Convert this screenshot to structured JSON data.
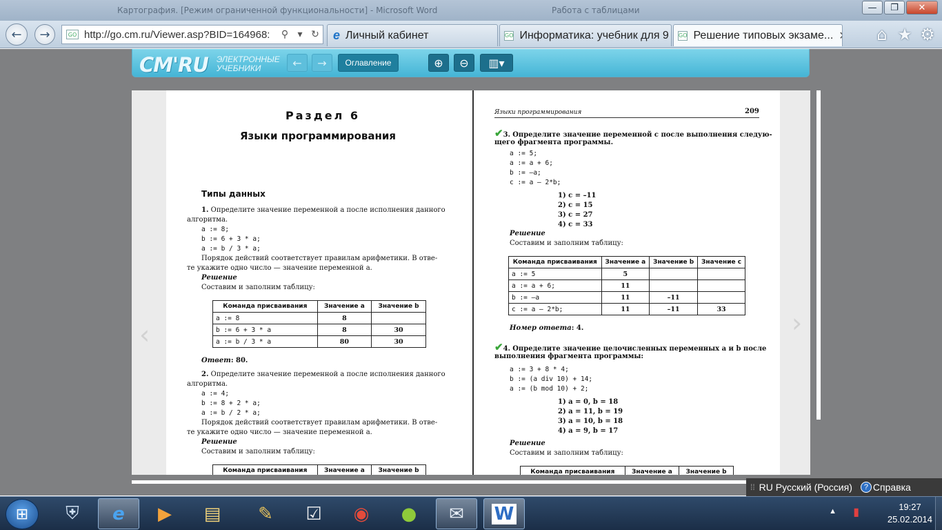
{
  "window": {
    "ghost_title": "Картография. [Режим ограниченной функциональности] - Microsoft Word",
    "ghost_title2": "Работа с таблицами",
    "buttons": {
      "minimize": "—",
      "maximize": "❐",
      "close": "✕"
    }
  },
  "browser": {
    "address": {
      "url": "http://go.cm.ru/Viewer.asp?BID=164968:",
      "favicon": "GO"
    },
    "tabs": [
      {
        "label": "Личный кабинет",
        "icon": "ie-icon",
        "active": false
      },
      {
        "label": "Информатика: учебник для 9 ...",
        "icon": "go-favicon",
        "active": false
      },
      {
        "label": "Решение типовых экзаме...",
        "icon": "go-favicon",
        "active": true,
        "close": "✕"
      }
    ],
    "tools": {
      "home": "⌂",
      "favorites": "★",
      "settings": "⚙"
    }
  },
  "reader": {
    "logo": "CM'RU",
    "logo_sub1": "ЭЛЕКТРОННЫЕ",
    "logo_sub2": "УЧЕБНИКИ",
    "toc_label": "Оглавление",
    "prev_page": "‹",
    "next_page": "›"
  },
  "left_page": {
    "section": "Раздел 6",
    "chapter": "Языки программирования",
    "subheading": "Типы данных",
    "q1": {
      "num": "1.",
      "text1": "Определите значение переменной a после исполнения данного",
      "text2": "алгоритма.",
      "code": [
        "a := 8;",
        "b := 6 + 3 * a;",
        "a := b / 3 * a;"
      ],
      "note1": "Порядок действий соответствует правилам арифметики. В отве-",
      "note2": "те укажите одно число — значение переменной a.",
      "solution": "Решение",
      "fill": "Составим и заполним таблицу:",
      "table": {
        "headers": [
          "Команда присваивания",
          "Значение a",
          "Значение b"
        ],
        "rows": [
          [
            "a := 8",
            "8",
            ""
          ],
          [
            "b := 6 + 3 * a",
            "8",
            "30"
          ],
          [
            "a := b / 3 * a",
            "80",
            "30"
          ]
        ]
      },
      "answer_label": "Ответ",
      "answer": ": 80."
    },
    "q2": {
      "num": "2.",
      "text1": "Определите значение переменной a после исполнения данного",
      "text2": "алгоритма.",
      "code": [
        "a := 4;",
        "b := 8 + 2 * a;",
        "a := b / 2 * a;"
      ],
      "note1": "Порядок действий соответствует правилам арифметики. В отве-",
      "note2": "те укажите одно число — значение переменной a.",
      "solution": "Решение",
      "fill": "Составим и заполним таблицу:",
      "table_headers": [
        "Команда присваивания",
        "Значение a",
        "Значение b"
      ]
    }
  },
  "right_page": {
    "running_head": "Языки программирования",
    "page_num": "209",
    "q3": {
      "num": "3.",
      "text1": "Определите значение переменной c после выполнения следую-",
      "text2": "щего фрагмента программы.",
      "code": [
        "a := 5;",
        "a := a + 6;",
        "b := –a;",
        "c := a – 2*b;"
      ],
      "options": [
        "1) c = –11",
        "2) c = 15",
        "3) c = 27",
        "4) c = 33"
      ],
      "solution": "Решение",
      "fill": "Составим и заполним таблицу:",
      "table": {
        "headers": [
          "Команда присваивания",
          "Значение a",
          "Значение b",
          "Значение c"
        ],
        "rows": [
          [
            "a := 5",
            "5",
            "",
            ""
          ],
          [
            "a := a + 6;",
            "11",
            "",
            ""
          ],
          [
            "b := –a",
            "11",
            "–11",
            ""
          ],
          [
            "c := a – 2*b;",
            "11",
            "–11",
            "33"
          ]
        ]
      },
      "answer_label": "Номер ответа",
      "answer": ": 4."
    },
    "q4": {
      "num": "4.",
      "text1": "Определите значение целочисленных переменных a и b после",
      "text2": "выполнения фрагмента программы:",
      "code": [
        "a := 3 + 8 * 4;",
        "b := (a div 10) + 14;",
        "a := (b mod 10) + 2;"
      ],
      "options": [
        "1) a = 0, b = 18",
        "2) a = 11, b = 19",
        "3) a = 10, b = 18",
        "4) a = 9, b = 17"
      ],
      "solution": "Решение",
      "fill": "Составим и заполним таблицу:",
      "table_headers": [
        "Команда присваивания",
        "Значение a",
        "Значение b"
      ]
    }
  },
  "langbar": {
    "lang_code": "RU",
    "lang_name": "Русский (Россия)",
    "help": "Справка"
  },
  "taskbar": {
    "time": "19:27",
    "date": "25.02.2014"
  },
  "colors": {
    "reader_toolbar": "#45b5d6",
    "check": "#3aa63a",
    "taskbar": "#1b2e47"
  }
}
